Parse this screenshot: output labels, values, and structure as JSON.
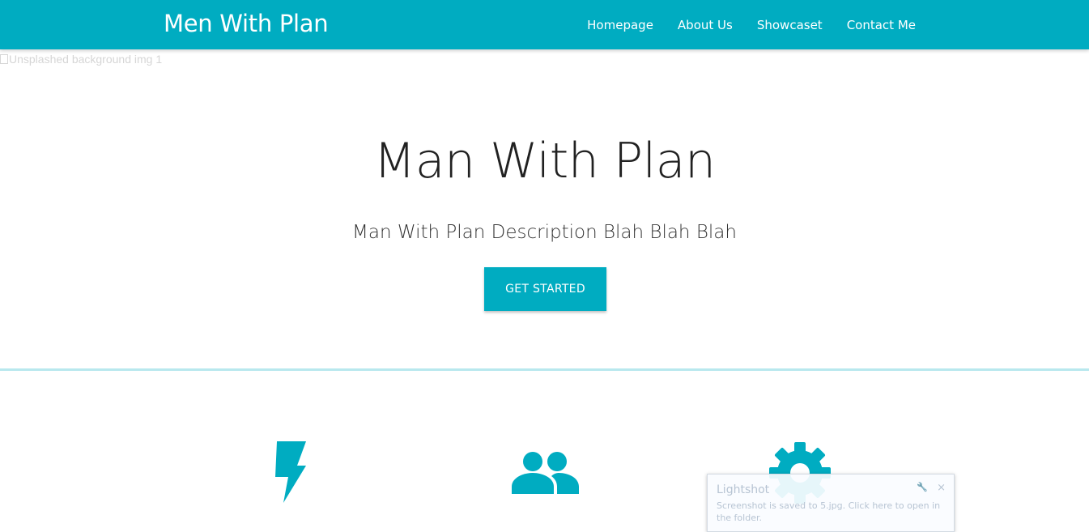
{
  "navbar": {
    "brand": "Men With Plan",
    "links": [
      "Homepage",
      "About Us",
      "Showcaset",
      "Contact Me"
    ],
    "color": "#00acc1"
  },
  "hero": {
    "image_alt": "Unsplashed background img 1",
    "title": "Man With Plan",
    "description": "Man With Plan Description Blah Blah Blah",
    "cta_label": "GET STARTED"
  },
  "features": {
    "icons": [
      "lightning-bolt-icon",
      "people-icon",
      "settings-gear-icon"
    ]
  },
  "toast": {
    "title": "Lightshot",
    "message": "Screenshot is saved to 5.jpg. Click here to open in the folder.",
    "close": "×"
  }
}
